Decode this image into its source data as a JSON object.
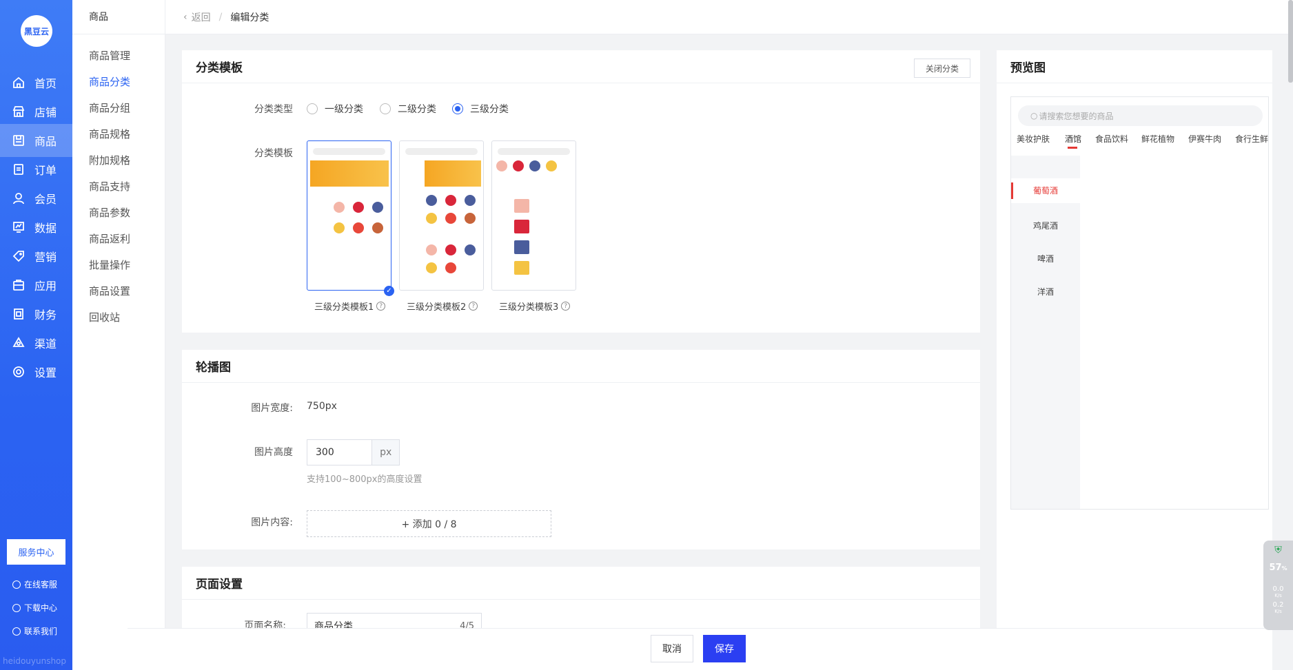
{
  "brand": {
    "logo_text": "黑豆云",
    "watermark": "heidouyunshop"
  },
  "nav": {
    "items": [
      {
        "label": "首页",
        "icon": "home-icon"
      },
      {
        "label": "店铺",
        "icon": "store-icon"
      },
      {
        "label": "商品",
        "icon": "goods-icon",
        "active": true
      },
      {
        "label": "订单",
        "icon": "order-icon"
      },
      {
        "label": "会员",
        "icon": "user-icon"
      },
      {
        "label": "数据",
        "icon": "chart-icon"
      },
      {
        "label": "营销",
        "icon": "tag-icon"
      },
      {
        "label": "应用",
        "icon": "app-icon"
      },
      {
        "label": "财务",
        "icon": "finance-icon"
      },
      {
        "label": "渠道",
        "icon": "channel-icon"
      },
      {
        "label": "设置",
        "icon": "gear-icon"
      }
    ],
    "service_center": "服务中心",
    "online_service": "在线客服",
    "download_center": "下载中心",
    "contact_us": "联系我们"
  },
  "submenu": {
    "title": "商品",
    "items": [
      "商品管理",
      "商品分类",
      "商品分组",
      "商品规格",
      "附加规格",
      "商品支持",
      "商品参数",
      "商品返利",
      "批量操作",
      "商品设置",
      "回收站"
    ],
    "active": "商品分类"
  },
  "topbar": {
    "back": "返回",
    "separator": "/",
    "title": "编辑分类"
  },
  "template_card": {
    "title": "分类模板",
    "close_button": "关闭分类",
    "type_label": "分类类型",
    "type_options": [
      "一级分类",
      "二级分类",
      "三级分类"
    ],
    "selected_type": "三级分类",
    "template_label": "分类模板",
    "templates": [
      "三级分类模板1",
      "三级分类模板2",
      "三级分类模板3"
    ],
    "selected_template": "三级分类模板1",
    "help_icon": "question-icon"
  },
  "banner_card": {
    "title": "轮播图",
    "width_label": "图片宽度:",
    "width_value": "750px",
    "height_label": "图片高度",
    "height_value": "300",
    "height_unit": "px",
    "height_hint": "支持100~800px的高度设置",
    "content_label": "图片内容:",
    "add_label": "+ 添加 0 / 8"
  },
  "page_card": {
    "title": "页面设置",
    "name_label": "页面名称:",
    "name_value": "商品分类",
    "name_count": "4/5"
  },
  "preview": {
    "title": "预览图",
    "search_placeholder": "请搜索您想要的商品",
    "tabs": [
      "美妆护肤",
      "酒馆",
      "食品饮料",
      "鲜花植物",
      "伊赛牛肉",
      "食行生鲜"
    ],
    "active_tab": "酒馆",
    "categories": [
      "葡萄酒",
      "鸡尾酒",
      "啤酒",
      "洋酒"
    ],
    "active_category": "葡萄酒"
  },
  "footer": {
    "cancel": "取消",
    "save": "保存"
  },
  "widget": {
    "percent": "57",
    "percent_unit": "%",
    "up": "0.0",
    "down": "0.2",
    "rate_unit": "K/s"
  },
  "colors": {
    "primary": "#2b63f2",
    "save": "#2b3ff2",
    "accent_red": "#e53935"
  }
}
